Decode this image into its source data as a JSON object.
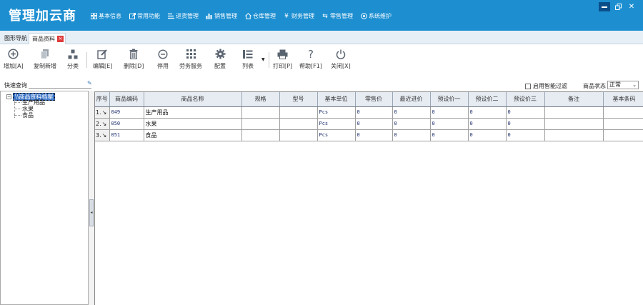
{
  "app": {
    "title": "管理加云商"
  },
  "main_menu": [
    {
      "label": "基本信息",
      "icon": "grid-icon"
    },
    {
      "label": "常用功能",
      "icon": "external-link-icon"
    },
    {
      "label": "进货管理",
      "icon": "list-icon"
    },
    {
      "label": "销售管理",
      "icon": "bar-chart-icon"
    },
    {
      "label": "仓库管理",
      "icon": "home-icon"
    },
    {
      "label": "财务管理",
      "icon": "yen-icon"
    },
    {
      "label": "零售管理",
      "icon": "arrows-icon"
    },
    {
      "label": "系统维护",
      "icon": "target-icon"
    }
  ],
  "tabs": [
    {
      "label": "图形导航"
    },
    {
      "label": "商品资料"
    }
  ],
  "toolbar": [
    {
      "label": "增加[A]",
      "icon": "plus-circle-icon"
    },
    {
      "label": "复制新增",
      "icon": "copy-icon"
    },
    {
      "label": "分类",
      "icon": "hierarchy-icon"
    },
    {
      "label": "编辑[E]",
      "icon": "edit-icon"
    },
    {
      "label": "删除[D]",
      "icon": "trash-icon"
    },
    {
      "label": "停用",
      "icon": "disable-icon"
    },
    {
      "label": "劳务服务",
      "icon": "dots-grid-icon"
    },
    {
      "label": "配置",
      "icon": "gear-icon"
    },
    {
      "label": "列表",
      "icon": "list-view-icon"
    },
    {
      "label": "打印[P]",
      "icon": "printer-icon"
    },
    {
      "label": "帮助[F1]",
      "icon": "help-icon"
    },
    {
      "label": "关闭[X]",
      "icon": "power-icon"
    }
  ],
  "filter": {
    "search_label": "快速查询",
    "search_value": "",
    "smart_filter_label": "启用智能过滤",
    "smart_filter_checked": false,
    "status_label": "商品状态",
    "status_value": "正常"
  },
  "tree": {
    "root": "\\\\商品资料档案",
    "children": [
      "生产用品",
      "水果",
      "食品"
    ]
  },
  "grid": {
    "columns": [
      "序号",
      "商品编码",
      "商品名称",
      "规格",
      "型号",
      "基本单位",
      "零售价",
      "最近进价",
      "预设价一",
      "预设价二",
      "预设价三",
      "备注",
      "基本条码"
    ],
    "rows": [
      {
        "seq": "1.",
        "code": "049",
        "name": "生产用品",
        "spec": "",
        "model": "",
        "unit": "Pcs",
        "retail": "0",
        "last_in": "0",
        "p1": "0",
        "p2": "0",
        "p3": "0",
        "note": "",
        "barcode": ""
      },
      {
        "seq": "2.",
        "code": "050",
        "name": "水果",
        "spec": "",
        "model": "",
        "unit": "Pcs",
        "retail": "0",
        "last_in": "0",
        "p1": "0",
        "p2": "0",
        "p3": "0",
        "note": "",
        "barcode": ""
      },
      {
        "seq": "3.",
        "code": "051",
        "name": "食品",
        "spec": "",
        "model": "",
        "unit": "Pcs",
        "retail": "0",
        "last_in": "0",
        "p1": "0",
        "p2": "0",
        "p3": "0",
        "note": "",
        "barcode": ""
      }
    ]
  },
  "colors": {
    "header_bg": "#1d8fd1",
    "selection": "#3a73c6",
    "close_tab": "#e03b3b"
  }
}
